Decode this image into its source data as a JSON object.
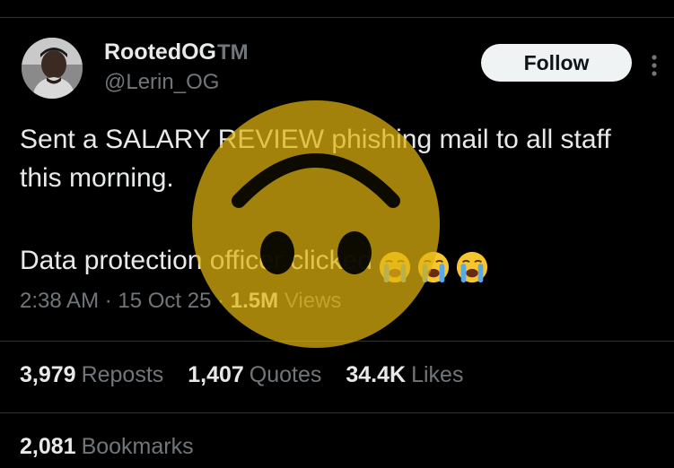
{
  "user": {
    "display_name": "RootedOG",
    "tm": "TM",
    "handle": "@Lerin_OG"
  },
  "follow_button": {
    "label": "Follow"
  },
  "tweet": {
    "line1": "Sent a SALARY REVIEW phishing mail to all staff this morning.",
    "line2": "Data protection officer clicked",
    "emojis": [
      "loudly-crying-face",
      "loudly-crying-face",
      "loudly-crying-face"
    ]
  },
  "meta": {
    "time": "2:38 AM",
    "separator": " · ",
    "date": "15 Oct 25",
    "views_count": "1.5M",
    "views_label": "Views"
  },
  "stats": {
    "reposts": {
      "count": "3,979",
      "label": "Reposts"
    },
    "quotes": {
      "count": "1,407",
      "label": "Quotes"
    },
    "likes": {
      "count": "34.4K",
      "label": "Likes"
    },
    "bookmarks": {
      "count": "2,081",
      "label": "Bookmarks"
    }
  },
  "overlay": {
    "icon": "upside-down-face-icon",
    "color": "#e0b40f"
  },
  "colors": {
    "background": "#000000",
    "text": "#e7e9ea",
    "muted": "#71767b",
    "divider": "#2f3336",
    "follow_bg": "#eff3f4"
  }
}
